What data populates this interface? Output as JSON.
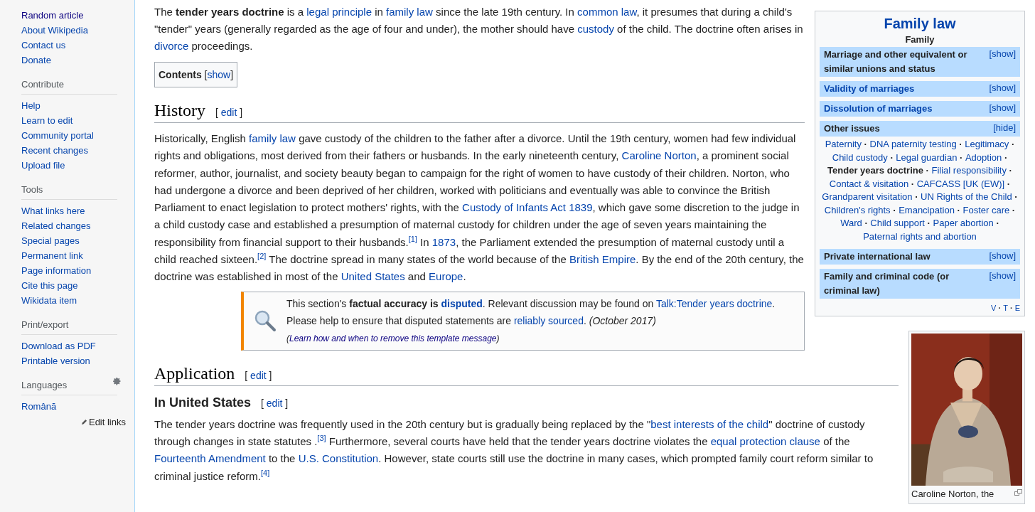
{
  "sidebar": {
    "items": [
      {
        "label": "Random article",
        "visited": true
      },
      {
        "label": "About Wikipedia",
        "visited": false
      },
      {
        "label": "Contact us",
        "visited": false
      },
      {
        "label": "Donate",
        "visited": false
      }
    ],
    "sections": [
      {
        "heading": "Contribute",
        "kind": "plain",
        "items": [
          {
            "label": "Help",
            "visited": false
          },
          {
            "label": "Learn to edit",
            "visited": false
          },
          {
            "label": "Community portal",
            "visited": false
          },
          {
            "label": "Recent changes",
            "visited": false
          },
          {
            "label": "Upload file",
            "visited": false
          }
        ]
      },
      {
        "heading": "Tools",
        "kind": "plain",
        "items": [
          {
            "label": "What links here",
            "visited": false
          },
          {
            "label": "Related changes",
            "visited": false
          },
          {
            "label": "Special pages",
            "visited": false
          },
          {
            "label": "Permanent link",
            "visited": false
          },
          {
            "label": "Page information",
            "visited": false
          },
          {
            "label": "Cite this page",
            "visited": false
          },
          {
            "label": "Wikidata item",
            "visited": false
          }
        ]
      },
      {
        "heading": "Print/export",
        "kind": "plain",
        "items": [
          {
            "label": "Download as PDF",
            "visited": false
          },
          {
            "label": "Printable version",
            "visited": false
          }
        ]
      },
      {
        "heading": "Languages",
        "kind": "languages",
        "items": [
          {
            "label": "Română",
            "visited": false
          }
        ],
        "edit_links": "Edit links"
      }
    ]
  },
  "article": {
    "intro": [
      {
        "kind": "text",
        "t": "The "
      },
      {
        "kind": "bold",
        "t": "tender years doctrine"
      },
      {
        "kind": "text",
        "t": " is a "
      },
      {
        "kind": "link",
        "t": "legal principle"
      },
      {
        "kind": "text",
        "t": " in "
      },
      {
        "kind": "link",
        "t": "family law"
      },
      {
        "kind": "text",
        "t": " since the late 19th century. In "
      },
      {
        "kind": "link",
        "t": "common law"
      },
      {
        "kind": "text",
        "t": ", it presumes that during a child's \"tender\" years (generally regarded as the age of four and under), the mother should have "
      },
      {
        "kind": "link",
        "t": "custody"
      },
      {
        "kind": "text",
        "t": " of the child. The doctrine often arises in "
      },
      {
        "kind": "link",
        "t": "divorce"
      },
      {
        "kind": "text",
        "t": " proceedings."
      }
    ],
    "contents": [
      {
        "kind": "bold",
        "t": "Contents"
      },
      {
        "kind": "text",
        "t": " ["
      },
      {
        "kind": "link",
        "t": "show"
      },
      {
        "kind": "text",
        "t": "]"
      }
    ],
    "sections": [
      {
        "kind": "h2",
        "title": "History",
        "edit": [
          {
            "kind": "text",
            "t": "[ "
          },
          {
            "kind": "link",
            "t": "edit"
          },
          {
            "kind": "text",
            "t": " ]"
          }
        ],
        "paragraphs": [
          [
            {
              "kind": "text",
              "t": "Historically, English "
            },
            {
              "kind": "link",
              "t": "family law"
            },
            {
              "kind": "text",
              "t": " gave custody of the children to the father after a divorce. Until the 19th century, women had few individual rights and obligations, most derived from their fathers or husbands. In the early nineteenth century, "
            },
            {
              "kind": "link",
              "t": "Caroline Norton"
            },
            {
              "kind": "text",
              "t": ", a prominent social reformer, author, journalist, and society beauty began to campaign for the right of women to have custody of their children. Norton, who had undergone a divorce and been deprived of her children, worked with politicians and eventually was able to convince the British Parliament to enact legislation to protect mothers' rights, with the "
            },
            {
              "kind": "link",
              "t": "Custody of Infants Act 1839"
            },
            {
              "kind": "text",
              "t": ", which gave some discretion to the judge in a child custody case and established a presumption of maternal custody for children under the age of seven years maintaining the responsibility from financial support to their husbands."
            },
            {
              "kind": "ref",
              "t": "[1]"
            },
            {
              "kind": "text",
              "t": " In "
            },
            {
              "kind": "link",
              "t": "1873"
            },
            {
              "kind": "text",
              "t": ", the Parliament extended the presumption of maternal custody until a child reached sixteen."
            },
            {
              "kind": "ref",
              "t": "[2]"
            },
            {
              "kind": "text",
              "t": " The doctrine spread in many states of the world because of the "
            },
            {
              "kind": "link",
              "t": "British Empire"
            },
            {
              "kind": "text",
              "t": ". By the end of the 20th century, the doctrine was established in most of the "
            },
            {
              "kind": "link",
              "t": "United States"
            },
            {
              "kind": "text",
              "t": " and "
            },
            {
              "kind": "link",
              "t": "Europe"
            },
            {
              "kind": "text",
              "t": "."
            }
          ]
        ],
        "notice": [
          {
            "kind": "text",
            "t": "This section's "
          },
          {
            "kind": "bold",
            "t": "factual accuracy is "
          },
          {
            "kind": "link_bold",
            "t": "disputed"
          },
          {
            "kind": "text",
            "t": ". Relevant discussion may be found on "
          },
          {
            "kind": "link",
            "t": "Talk:Tender years doctrine"
          },
          {
            "kind": "text",
            "t": ". Please help to ensure that disputed statements are "
          },
          {
            "kind": "link",
            "t": "reliably sourced"
          },
          {
            "kind": "text",
            "t": ". "
          },
          {
            "kind": "italic",
            "t": "(October 2017) "
          },
          {
            "kind": "small_italic",
            "t": "("
          },
          {
            "kind": "small_link",
            "t": "Learn how and when to remove this template message"
          },
          {
            "kind": "small_italic",
            "t": ")"
          }
        ]
      },
      {
        "kind": "h2",
        "title": "Application",
        "edit": [
          {
            "kind": "text",
            "t": "[ "
          },
          {
            "kind": "link",
            "t": "edit"
          },
          {
            "kind": "text",
            "t": " ]"
          }
        ]
      },
      {
        "kind": "h3",
        "title": "In United States",
        "edit": [
          {
            "kind": "text",
            "t": "[ "
          },
          {
            "kind": "link",
            "t": "edit"
          },
          {
            "kind": "text",
            "t": " ]"
          }
        ],
        "paragraphs": [
          [
            {
              "kind": "text",
              "t": "The tender years doctrine was frequently used in the 20th century but is gradually being replaced by the \""
            },
            {
              "kind": "link",
              "t": "best interests of the child"
            },
            {
              "kind": "text",
              "t": "\" doctrine of custody through changes in state statutes ."
            },
            {
              "kind": "ref",
              "t": "[3]"
            },
            {
              "kind": "text",
              "t": " Furthermore, several courts have held that the tender years doctrine violates the "
            },
            {
              "kind": "link",
              "t": "equal protection clause"
            },
            {
              "kind": "text",
              "t": " of the "
            },
            {
              "kind": "link",
              "t": "Fourteenth Amendment"
            },
            {
              "kind": "text",
              "t": " to the "
            },
            {
              "kind": "link",
              "t": "U.S. Constitution"
            },
            {
              "kind": "text",
              "t": ". However, state courts still use the doctrine in many cases, which prompted family court reform similar to criminal justice reform."
            },
            {
              "kind": "ref",
              "t": "[4]"
            }
          ]
        ]
      }
    ]
  },
  "navbox": {
    "title": "Family law",
    "subtitle": "Family",
    "groups": [
      {
        "title": "Marriage and other equivalent or similar unions and status",
        "kind": "plain",
        "toggle": "[show]",
        "expanded": false
      },
      {
        "title": "Validity of marriages",
        "kind": "link",
        "toggle": "[show]",
        "expanded": false
      },
      {
        "title": "Dissolution of marriages",
        "kind": "link",
        "toggle": "[show]",
        "expanded": false
      },
      {
        "title": "Other issues",
        "kind": "plain",
        "toggle": "[hide]",
        "expanded": true,
        "items": [
          {
            "kind": "link",
            "t": "Paternity"
          },
          {
            "kind": "separator",
            "t": " · "
          },
          {
            "kind": "link",
            "t": "DNA paternity testing"
          },
          {
            "kind": "separator",
            "t": " · "
          },
          {
            "kind": "link",
            "t": "Legitimacy"
          },
          {
            "kind": "separator",
            "t": " · "
          },
          {
            "kind": "link",
            "t": "Child custody"
          },
          {
            "kind": "separator",
            "t": " · "
          },
          {
            "kind": "link",
            "t": "Legal guardian"
          },
          {
            "kind": "separator",
            "t": " · "
          },
          {
            "kind": "link",
            "t": "Adoption"
          },
          {
            "kind": "separator",
            "t": " · "
          },
          {
            "kind": "current",
            "t": "Tender years doctrine"
          },
          {
            "kind": "separator",
            "t": " · "
          },
          {
            "kind": "link",
            "t": "Filial responsibility"
          },
          {
            "kind": "separator",
            "t": " · "
          },
          {
            "kind": "link",
            "t": "Contact & visitation"
          },
          {
            "kind": "separator",
            "t": " · "
          },
          {
            "kind": "link",
            "t": "CAFCASS [UK (EW)]"
          },
          {
            "kind": "separator",
            "t": " · "
          },
          {
            "kind": "link",
            "t": "Grandparent visitation"
          },
          {
            "kind": "separator",
            "t": " · "
          },
          {
            "kind": "link",
            "t": "UN Rights of the Child"
          },
          {
            "kind": "separator",
            "t": " · "
          },
          {
            "kind": "link",
            "t": "Children's rights"
          },
          {
            "kind": "separator",
            "t": " · "
          },
          {
            "kind": "link",
            "t": "Emancipation"
          },
          {
            "kind": "separator",
            "t": " · "
          },
          {
            "kind": "link",
            "t": "Foster care"
          },
          {
            "kind": "separator",
            "t": " · "
          },
          {
            "kind": "link",
            "t": "Ward"
          },
          {
            "kind": "separator",
            "t": " · "
          },
          {
            "kind": "link",
            "t": "Child support"
          },
          {
            "kind": "separator",
            "t": " · "
          },
          {
            "kind": "link",
            "t": "Paper abortion"
          },
          {
            "kind": "separator",
            "t": " · "
          },
          {
            "kind": "link",
            "t": "Paternal rights and abortion"
          }
        ]
      },
      {
        "title": "Private international law",
        "kind": "plain",
        "toggle": "[show]",
        "expanded": false
      },
      {
        "title": "Family and criminal code (or criminal law)",
        "kind": "plain",
        "toggle": "[show]",
        "expanded": false
      }
    ],
    "footer": [
      {
        "kind": "link",
        "t": "V"
      },
      {
        "kind": "separator",
        "t": " · "
      },
      {
        "kind": "link",
        "t": "T"
      },
      {
        "kind": "separator",
        "t": " · "
      },
      {
        "kind": "link",
        "t": "E"
      }
    ]
  },
  "figure": {
    "kind": "picture",
    "caption": "Caroline Norton, the"
  }
}
